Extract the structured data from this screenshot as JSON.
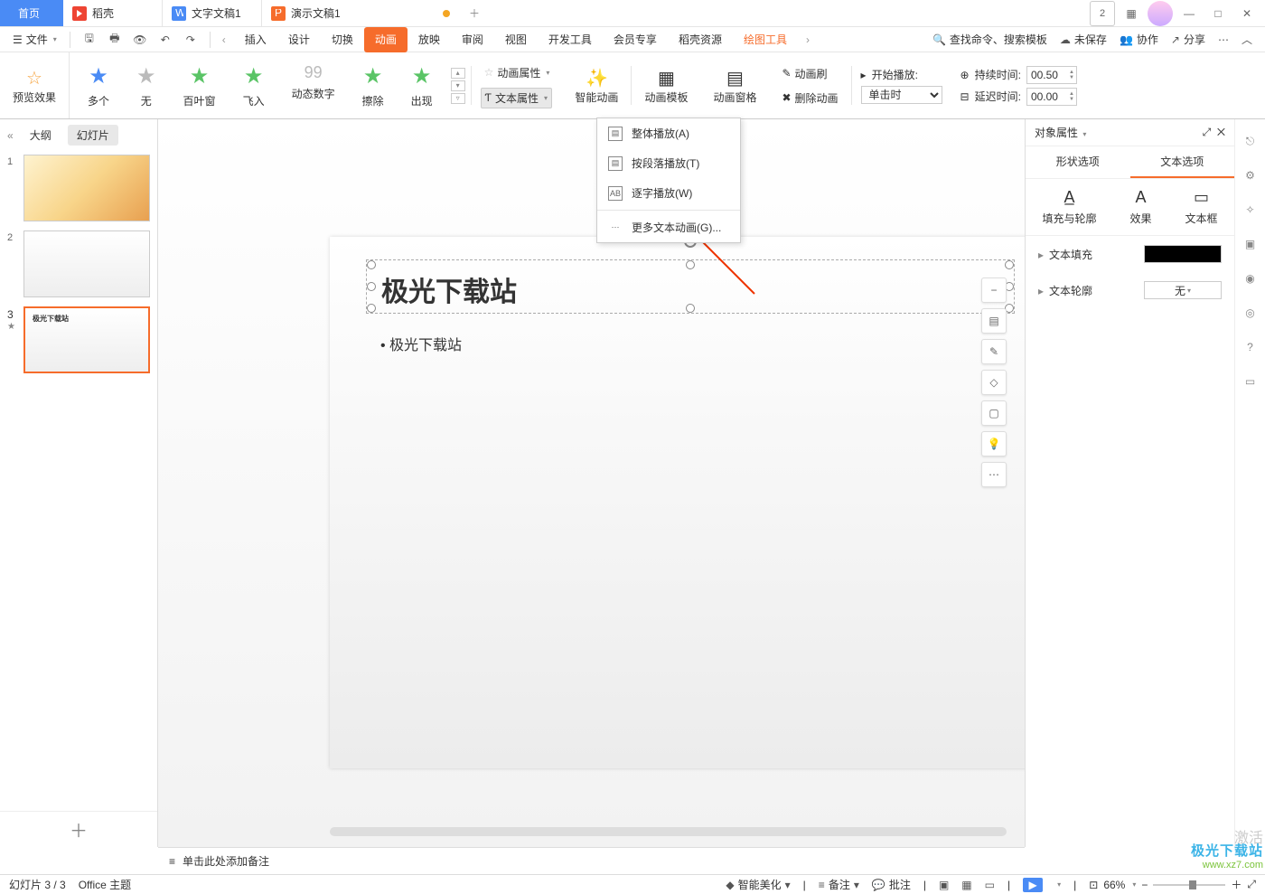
{
  "titlebar": {
    "home": "首页",
    "tabs": [
      {
        "icon": "dk",
        "label": "稻壳"
      },
      {
        "icon": "w",
        "label": "文字文稿1"
      },
      {
        "icon": "p",
        "label": "演示文稿1",
        "dirty": true,
        "active": true
      }
    ],
    "badge": "2"
  },
  "menubar": {
    "file": "文件",
    "tabs": [
      "插入",
      "设计",
      "切换",
      "动画",
      "放映",
      "审阅",
      "视图",
      "开发工具",
      "会员专享",
      "稻壳资源"
    ],
    "active_index": 3,
    "context_tab": "绘图工具",
    "search_placeholder": "查找命令、搜索模板",
    "right": [
      "未保存",
      "协作",
      "分享"
    ]
  },
  "ribbon": {
    "preview": "预览效果",
    "effects": [
      {
        "label": "多个",
        "star": "★",
        "cls": "c1"
      },
      {
        "label": "无",
        "star": "★",
        "cls": "c0"
      },
      {
        "label": "百叶窗",
        "star": "★",
        "cls": "c2"
      },
      {
        "label": "飞入",
        "star": "★",
        "cls": "c3"
      },
      {
        "label": "动态数字",
        "star": "99",
        "cls": "c4"
      },
      {
        "label": "擦除",
        "star": "★",
        "cls": "c5"
      },
      {
        "label": "出现",
        "star": "★",
        "cls": "c6"
      }
    ],
    "anim_props": "动画属性",
    "text_props": "文本属性",
    "smart_anim": "智能动画",
    "anim_tpl": "动画模板",
    "anim_pane": "动画窗格",
    "anim_brush": "动画刷",
    "del_anim": "删除动画",
    "start": "开始播放:",
    "start_opt": "单击时",
    "duration": "持续时间:",
    "duration_val": "00.50",
    "delay": "延迟时间:",
    "delay_val": "00.00"
  },
  "dropdown": {
    "items": [
      {
        "icon": "▤",
        "label": "整体播放(A)"
      },
      {
        "icon": "▤",
        "label": "按段落播放(T)"
      },
      {
        "icon": "AB",
        "label": "逐字播放(W)"
      }
    ],
    "more": "更多文本动画(G)..."
  },
  "leftpane": {
    "outline": "大纲",
    "slides": "幻灯片",
    "thumbs": [
      {
        "num": "1",
        "flower": true
      },
      {
        "num": "2"
      },
      {
        "num": "3",
        "selected": true,
        "title": "极光下载站",
        "hasAnim": true
      }
    ]
  },
  "slide": {
    "title": "极光下载站",
    "bullet": "• 极光下载站"
  },
  "rightpane": {
    "header": "对象属性",
    "tab1": "形状选项",
    "tab2": "文本选项",
    "sub1": "填充与轮廓",
    "sub2": "效果",
    "sub3": "文本框",
    "prop1": "文本填充",
    "prop2": "文本轮廓",
    "prop2_val": "无"
  },
  "notes": {
    "placeholder": "单击此处添加备注"
  },
  "statusbar": {
    "slide": "幻灯片 3 / 3",
    "theme": "Office 主题",
    "beautify": "智能美化",
    "notes": "备注",
    "comments": "批注",
    "zoom": "66%"
  },
  "watermark": {
    "l1": "极光下载站",
    "l2": "www.xz7.com"
  }
}
